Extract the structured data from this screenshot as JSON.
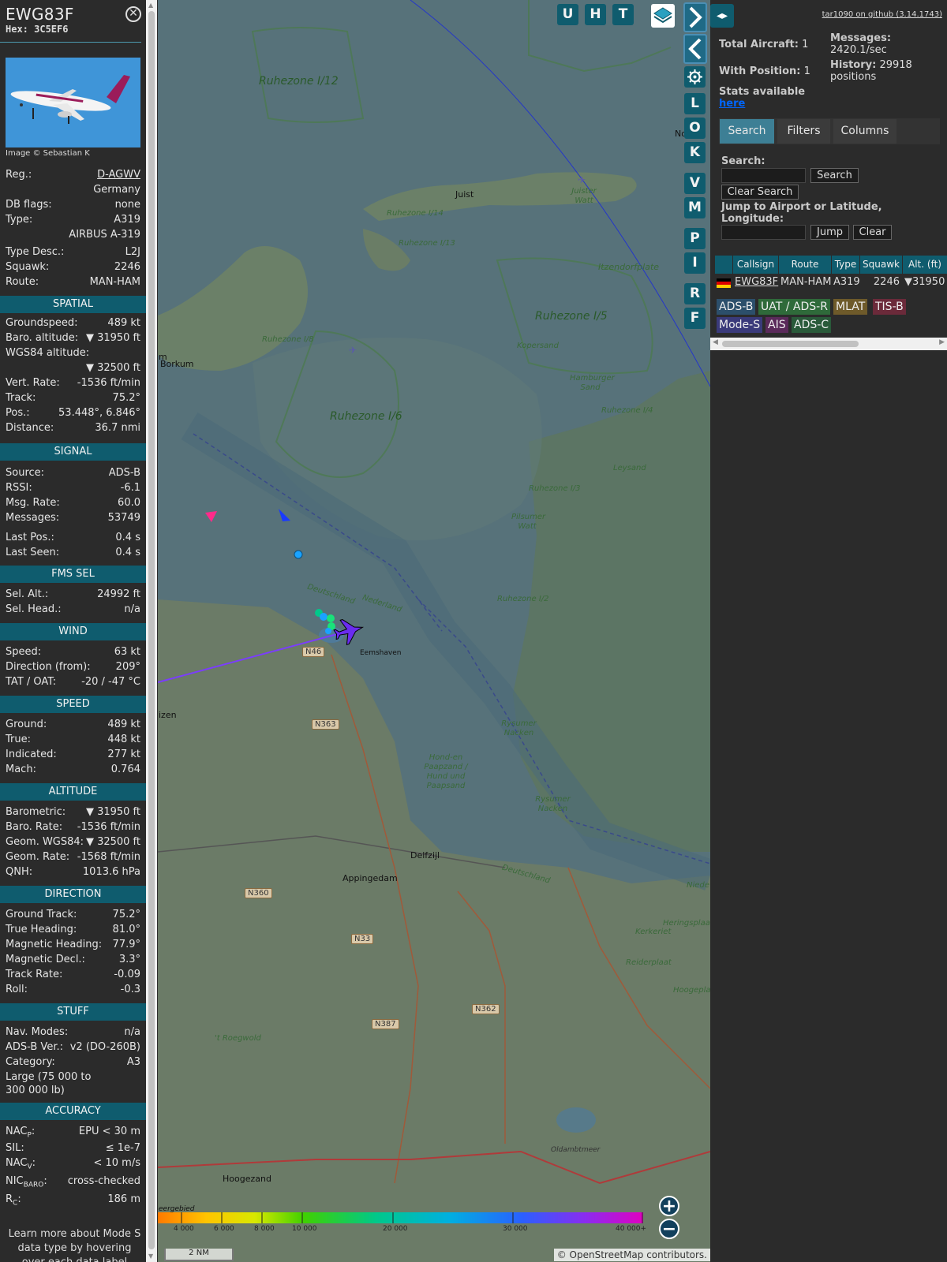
{
  "aircraft": {
    "callsign": "EWG83F",
    "hex_line": "Hex: 3C5EF6",
    "close_icon": "close-circle-icon",
    "photo_credit": "Image © Sebastian K",
    "details": [
      {
        "key": "Reg.:",
        "value": "D-AGWV"
      },
      {
        "key": "",
        "value": "Germany"
      },
      {
        "key": "DB flags:",
        "value": "none"
      },
      {
        "key": "Type:",
        "value": "A319"
      },
      {
        "key": "",
        "value": "AIRBUS A-319"
      },
      {
        "key": "Type Desc.:",
        "value": "L2J"
      },
      {
        "key": "Squawk:",
        "value": "2246"
      },
      {
        "key": "Route:",
        "value": "MAN-HAM"
      }
    ]
  },
  "sections": {
    "spatial": {
      "title": "SPATIAL",
      "rows": [
        {
          "key": "Groundspeed:",
          "value": "489 kt"
        },
        {
          "key": "Baro. altitude:",
          "value": "▼ 31950 ft"
        },
        {
          "key": "WGS84 altitude:",
          "value": ""
        },
        {
          "key": "",
          "value": "▼ 32500 ft"
        },
        {
          "key": "Vert. Rate:",
          "value": "-1536 ft/min"
        },
        {
          "key": "Track:",
          "value": "75.2°"
        },
        {
          "key": "Pos.:",
          "value": "53.448°, 6.846°"
        },
        {
          "key": "Distance:",
          "value": "36.7 nmi"
        }
      ]
    },
    "signal": {
      "title": "SIGNAL",
      "rows": [
        {
          "key": "Source:",
          "value": "ADS-B"
        },
        {
          "key": "RSSI:",
          "value": "-6.1"
        },
        {
          "key": "Msg. Rate:",
          "value": "60.0"
        },
        {
          "key": "Messages:",
          "value": "53749"
        },
        {
          "key": "Last Pos.:",
          "value": "0.4 s"
        },
        {
          "key": "Last Seen:",
          "value": "0.4 s"
        }
      ]
    },
    "fms": {
      "title": "FMS SEL",
      "rows": [
        {
          "key": "Sel. Alt.:",
          "value": "24992 ft"
        },
        {
          "key": "Sel. Head.:",
          "value": "n/a"
        }
      ]
    },
    "wind": {
      "title": "WIND",
      "rows": [
        {
          "key": "Speed:",
          "value": "63 kt"
        },
        {
          "key": "Direction (from):",
          "value": "209°"
        },
        {
          "key": "TAT / OAT:",
          "value": "-20 / -47 °C"
        }
      ]
    },
    "speed": {
      "title": "SPEED",
      "rows": [
        {
          "key": "Ground:",
          "value": "489 kt"
        },
        {
          "key": "True:",
          "value": "448 kt"
        },
        {
          "key": "Indicated:",
          "value": "277 kt"
        },
        {
          "key": "Mach:",
          "value": "0.764"
        }
      ]
    },
    "altitude": {
      "title": "ALTITUDE",
      "rows": [
        {
          "key": "Barometric:",
          "value": "▼ 31950 ft"
        },
        {
          "key": "Baro. Rate:",
          "value": "-1536 ft/min"
        },
        {
          "key": "Geom. WGS84:",
          "value": "▼ 32500 ft"
        },
        {
          "key": "Geom. Rate:",
          "value": "-1568 ft/min"
        },
        {
          "key": "QNH:",
          "value": "1013.6 hPa"
        }
      ]
    },
    "direction": {
      "title": "DIRECTION",
      "rows": [
        {
          "key": "Ground Track:",
          "value": "75.2°"
        },
        {
          "key": "True Heading:",
          "value": "81.0°"
        },
        {
          "key": "Magnetic Heading:",
          "value": "77.9°"
        },
        {
          "key": "Magnetic Decl.:",
          "value": "3.3°"
        },
        {
          "key": "Track Rate:",
          "value": "-0.09"
        },
        {
          "key": "Roll:",
          "value": "-0.3"
        }
      ]
    },
    "stuff": {
      "title": "STUFF",
      "rows": [
        {
          "key": "Nav. Modes:",
          "value": "n/a"
        },
        {
          "key": "ADS-B Ver.:",
          "value": "v2 (DO-260B)"
        },
        {
          "key": "Category:",
          "value": "A3"
        }
      ],
      "category_desc_1": "Large (75 000 to",
      "category_desc_2": "300 000 lb)"
    },
    "accuracy": {
      "title": "ACCURACY",
      "nacp_key": "NAC",
      "nacp_sub": "P",
      "nacp_value": "EPU < 30 m",
      "sil_key": "SIL:",
      "sil_value": "≤ 1e-7",
      "nacv_key": "NAC",
      "nacv_sub": "V",
      "nacv_value": "< 10 m/s",
      "nic_key": "NIC",
      "nic_sub": "BARO",
      "nic_value": "cross-checked",
      "rc_key": "R",
      "rc_sub": "C",
      "rc_value": "186 m"
    },
    "note": "Learn more about Mode S data type by hovering over each data label"
  },
  "map": {
    "buttons": {
      "u": "U",
      "h": "H",
      "t": "T",
      "l": "L",
      "o": "O",
      "k": "K",
      "v": "V",
      "m": "M",
      "p": "P",
      "i": "I",
      "r": "R",
      "f": "F"
    },
    "layers_icon": "layers-icon",
    "gear_icon": "gear-icon",
    "next_icon": "chevron-right-icon",
    "prev_icon": "chevron-left-icon",
    "toggle_icon": "expand-arrows-icon",
    "zoom_in": "+",
    "zoom_out": "−",
    "zones": [
      {
        "name": "Ruhezone I/12"
      },
      {
        "name": "Ruhezone I/14"
      },
      {
        "name": "Ruhezone I/13"
      },
      {
        "name": "Ruhezone I/5"
      },
      {
        "name": "Ruhezone I/6"
      },
      {
        "name": "Ruhezone I/4"
      },
      {
        "name": "Ruhezone I/3"
      },
      {
        "name": "Ruhezone I/2"
      },
      {
        "name": "Ruhezone I/8"
      }
    ],
    "places": {
      "juist": "Juist",
      "borkum": "Borkum",
      "eemshaven": "Eemshaven",
      "delfzijl": "Delfzijl",
      "appingedam": "Appingedam",
      "hoogezand": "Hoogezand",
      "oldambtmeer": "Oldambtmeer",
      "itzendorfplate": "Itzendorfplate",
      "kopersand": "Kopersand",
      "hamburger_sand": "Hamburger Sand",
      "leysand": "Leysand",
      "pilsumer_watt": "Pilsumer Watt",
      "juister_watt": "Juister Watt",
      "rysumer_nacken": "Rysumer Nacken",
      "hond_en_paapsand": "Hond-en Paapzand / Hund und Paapsand",
      "deutschland": "Deutschland",
      "nederland": "Nederland",
      "kerkeriet": "Kerkeriet",
      "reiderplaat": "Reiderplaat",
      "heringsplaat": "Heringsplaat",
      "hoogeplaat": "Hoogeplaat",
      "roegwold": "'t Roegwold",
      "niede": "Niede",
      "izen": "izen",
      "m": "m",
      "no": "No",
      "eergebied": "eergebied"
    },
    "roads": {
      "n46": "N46",
      "n363": "N363",
      "n360": "N360",
      "n33": "N33",
      "n387": "N387",
      "n362": "N362"
    },
    "altitude_scale": [
      "4 000",
      "6 000",
      "8 000",
      "10 000",
      "20 000",
      "30 000",
      "40 000+"
    ],
    "scale_label": "2 NM",
    "attribution": "© OpenStreetMap contributors."
  },
  "right": {
    "github_link": "tar1090 on github (3.14.1743)",
    "total_aircraft_label": "Total Aircraft:",
    "total_aircraft_value": "1",
    "with_position_label": "With Position:",
    "with_position_value": "1",
    "messages_label": "Messages:",
    "messages_value": "2420.1/sec",
    "history_label": "History:",
    "history_value": "29918",
    "history_unit": "positions",
    "stats_label": "Stats available",
    "stats_link": "here",
    "tabs": [
      "Search",
      "Filters",
      "Columns"
    ],
    "search_label": "Search:",
    "search_value": "",
    "search_button": "Search",
    "clear_search_button": "Clear Search",
    "jump_label": "Jump to Airport or Latitude, Longitude:",
    "jump_value": "",
    "jump_button": "Jump",
    "clear_button": "Clear",
    "columns": [
      "Callsign",
      "Route",
      "Type",
      "Squawk",
      "Alt. (ft)"
    ],
    "rows": [
      {
        "flag": "flag-germany-icon",
        "callsign": "EWG83F",
        "route": "MAN-HAM",
        "type": "A319",
        "squawk": "2246",
        "alt": "▼31950"
      }
    ],
    "legend": [
      {
        "label": "ADS-B",
        "color": "#2c4f6b"
      },
      {
        "label": "UAT / ADS-R",
        "color": "#2f6a3a"
      },
      {
        "label": "MLAT",
        "color": "#6e5a2a"
      },
      {
        "label": "TIS-B",
        "color": "#6b2a3a"
      },
      {
        "label": "Mode-S",
        "color": "#3a3a7a"
      },
      {
        "label": "AIS",
        "color": "#5a2a5a"
      },
      {
        "label": "ADS-C",
        "color": "#2a5a3a"
      }
    ]
  }
}
